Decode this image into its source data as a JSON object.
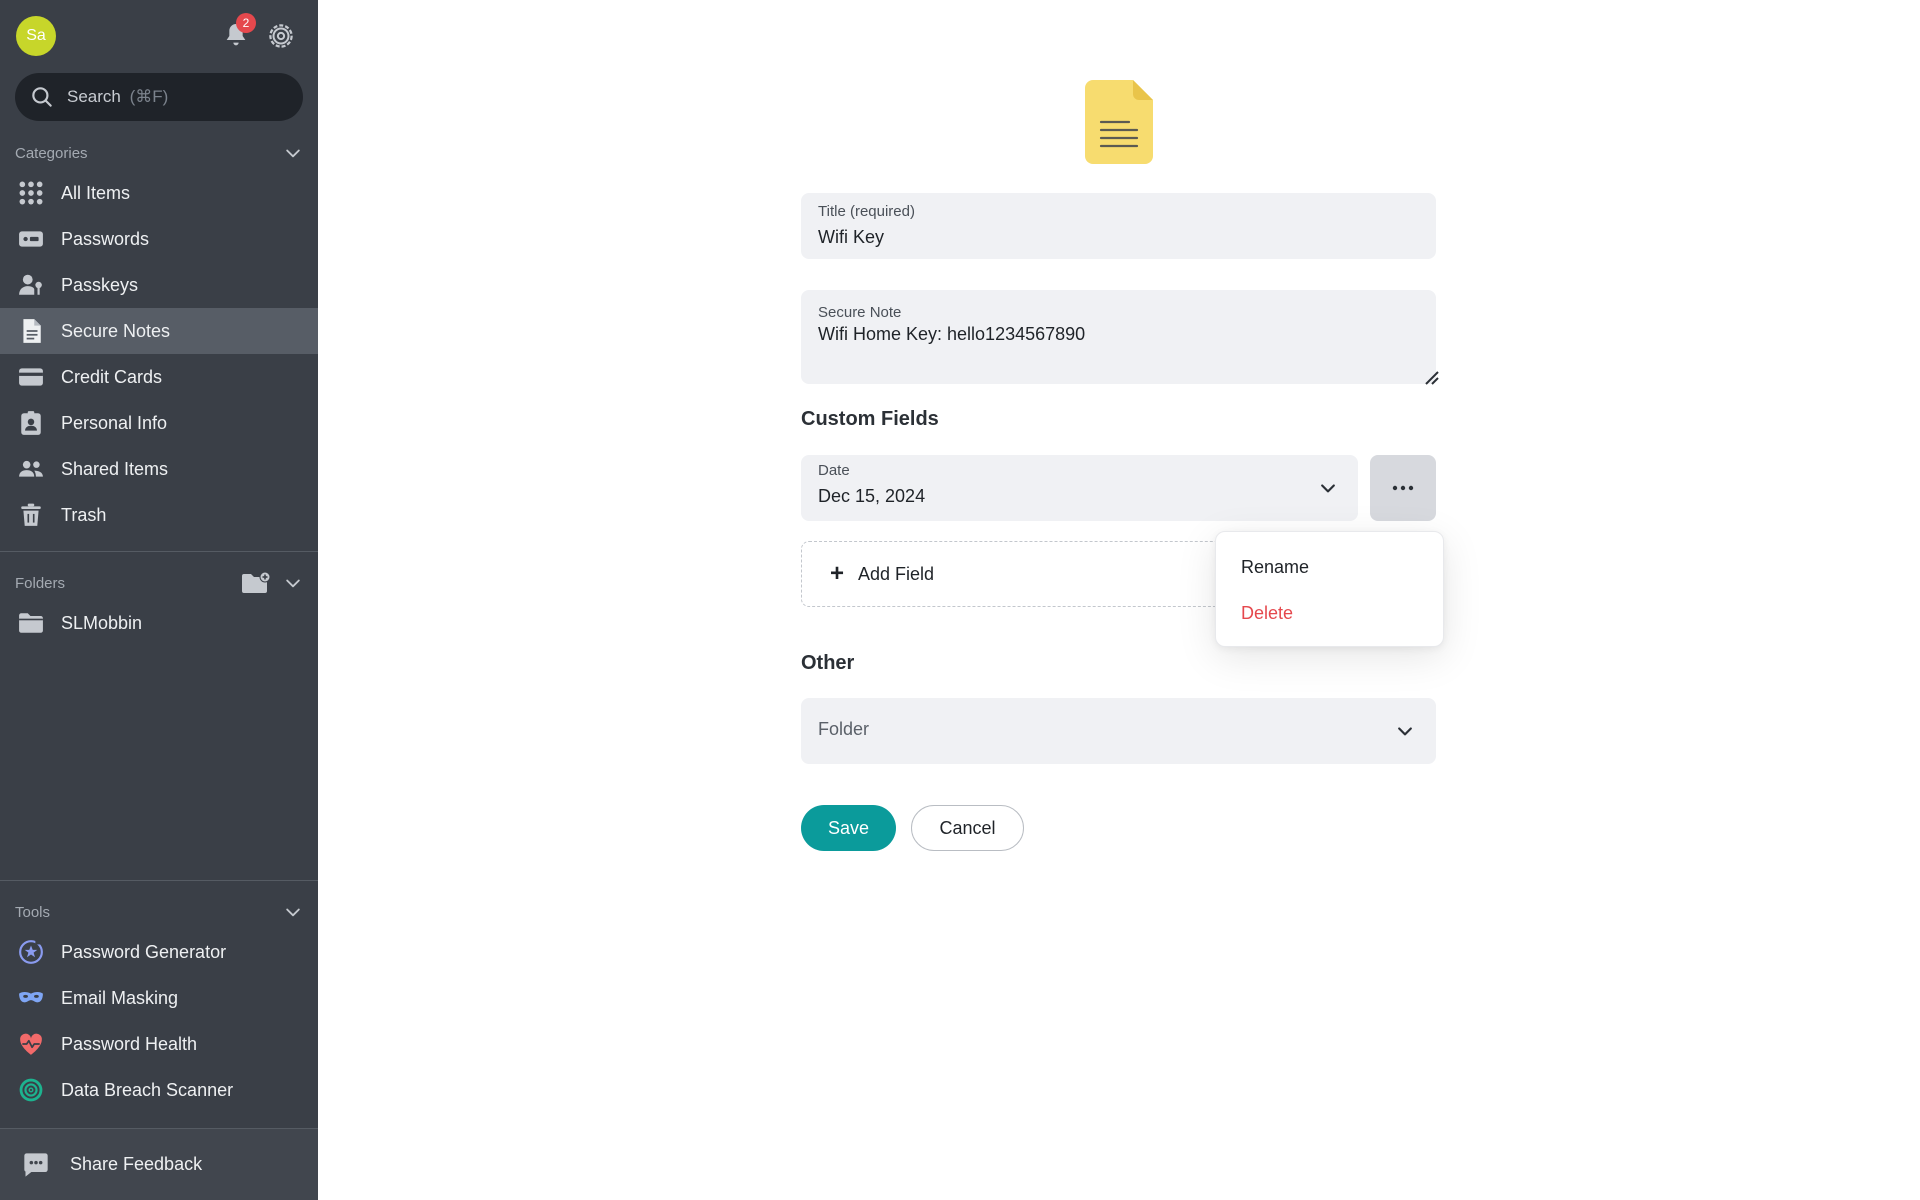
{
  "user": {
    "avatar_initials": "Sa"
  },
  "notifications": {
    "count": "2"
  },
  "search": {
    "label": "Search",
    "shortcut": "(⌘F)"
  },
  "categories": {
    "heading": "Categories",
    "items": [
      {
        "label": "All Items",
        "icon": "grid-icon"
      },
      {
        "label": "Passwords",
        "icon": "password-icon"
      },
      {
        "label": "Passkeys",
        "icon": "passkey-icon"
      },
      {
        "label": "Secure Notes",
        "icon": "note-icon",
        "active": true
      },
      {
        "label": "Credit Cards",
        "icon": "credit-card-icon"
      },
      {
        "label": "Personal Info",
        "icon": "id-badge-icon"
      },
      {
        "label": "Shared Items",
        "icon": "people-icon"
      },
      {
        "label": "Trash",
        "icon": "trash-icon"
      }
    ]
  },
  "folders": {
    "heading": "Folders",
    "items": [
      {
        "label": "SLMobbin",
        "icon": "folder-icon"
      }
    ]
  },
  "tools": {
    "heading": "Tools",
    "items": [
      {
        "label": "Password Generator",
        "icon": "generator-icon"
      },
      {
        "label": "Email Masking",
        "icon": "mask-icon"
      },
      {
        "label": "Password Health",
        "icon": "heart-pulse-icon"
      },
      {
        "label": "Data Breach Scanner",
        "icon": "radar-icon"
      }
    ]
  },
  "feedback": {
    "label": "Share Feedback"
  },
  "form": {
    "title_label": "Title (required)",
    "title_value": "Wifi Key",
    "note_label": "Secure Note",
    "note_value": "Wifi Home Key: hello1234567890",
    "custom_fields_heading": "Custom Fields",
    "date_label": "Date",
    "date_value": "Dec 15, 2024",
    "add_field_label": "Add Field",
    "other_heading": "Other",
    "folder_placeholder": "Folder",
    "save_label": "Save",
    "cancel_label": "Cancel"
  },
  "context_menu": {
    "rename_label": "Rename",
    "delete_label": "Delete"
  },
  "colors": {
    "sidebar_bg": "#3a3f47",
    "accent": "#0b9b9b",
    "danger": "#e5484d",
    "note_icon": "#f7dc6f"
  }
}
